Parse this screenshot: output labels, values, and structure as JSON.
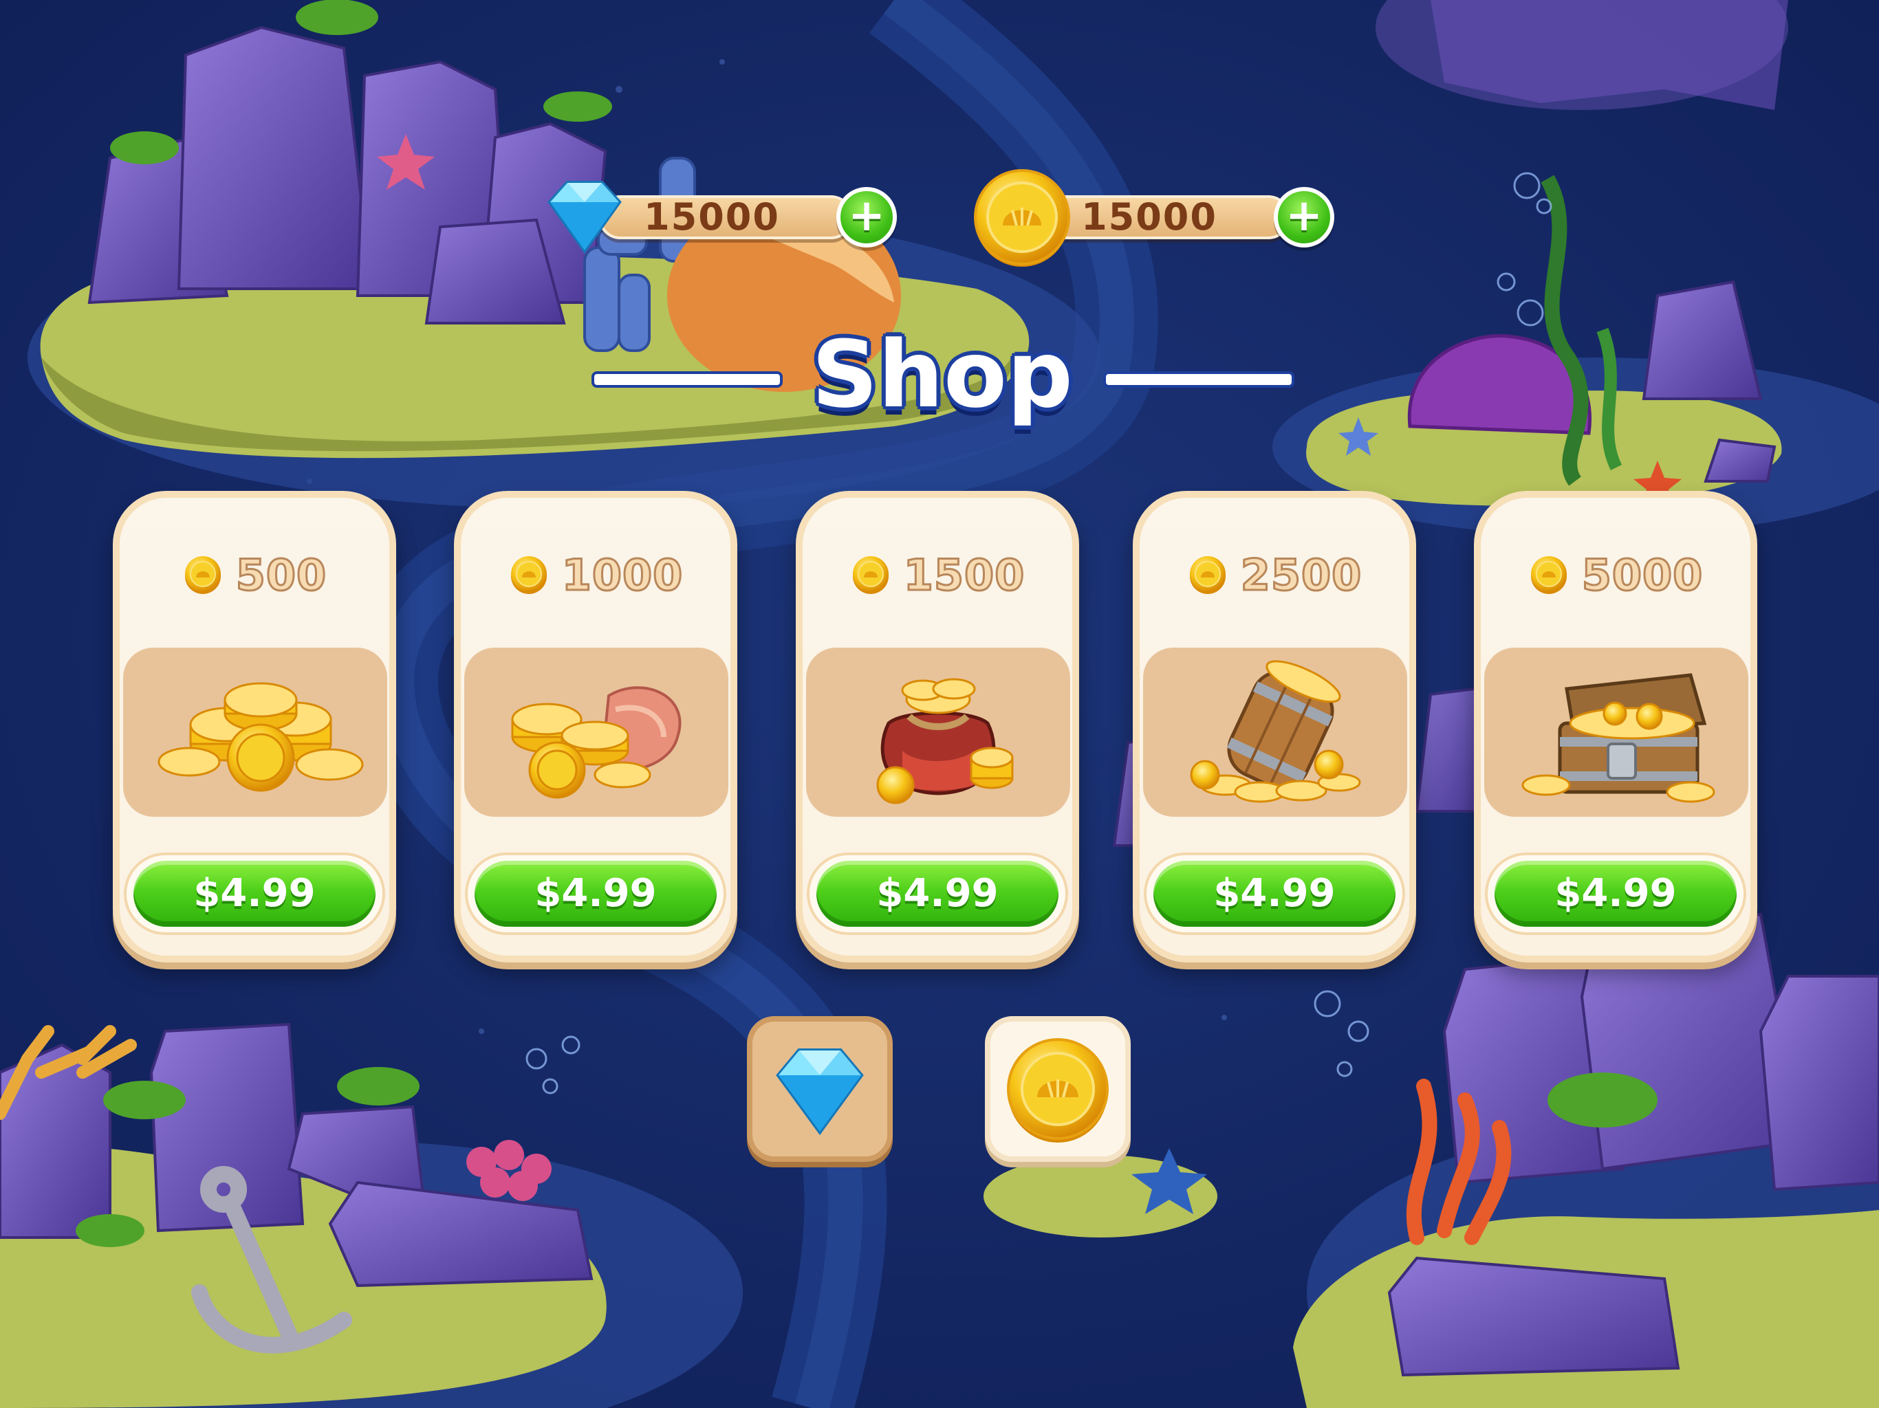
{
  "currency": {
    "gems": {
      "icon": "diamond-icon",
      "value": "15000",
      "plus_label": "+"
    },
    "coins": {
      "icon": "shell-coin-icon",
      "value": "15000",
      "plus_label": "+"
    }
  },
  "title": "Shop",
  "packs": [
    {
      "amount": "500",
      "art": "coin-stack-icon",
      "price": "$4.99"
    },
    {
      "amount": "1000",
      "art": "coins-shell-icon",
      "price": "$4.99"
    },
    {
      "amount": "1500",
      "art": "coin-bag-icon",
      "price": "$4.99"
    },
    {
      "amount": "2500",
      "art": "coin-barrel-icon",
      "price": "$4.99"
    },
    {
      "amount": "5000",
      "art": "treasure-chest-icon",
      "price": "$4.99"
    }
  ],
  "tabs": [
    {
      "icon": "diamond-icon",
      "selected": true
    },
    {
      "icon": "shell-coin-icon",
      "selected": false
    }
  ],
  "colors": {
    "water": "#162866",
    "sand": "#b6c25a",
    "rock": "#6b55b6",
    "buy_green": "#4fd01b",
    "card": "#fbf5ea",
    "title_outline": "#1d3f9e"
  }
}
